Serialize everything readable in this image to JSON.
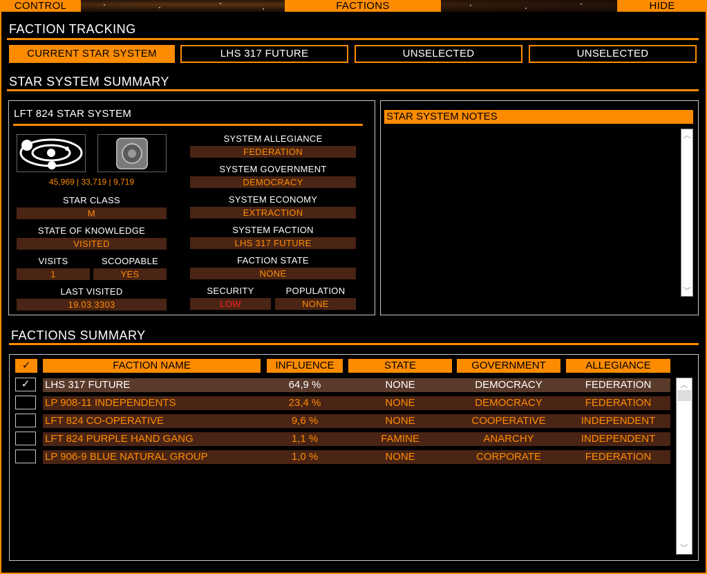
{
  "topbar": {
    "control": "CONTROL",
    "factions": "FACTIONS",
    "hide": "HIDE"
  },
  "tracking": {
    "title": "FACTION TRACKING",
    "buttons": [
      "CURRENT STAR SYSTEM",
      "LHS 317 FUTURE",
      "UNSELECTED",
      "UNSELECTED"
    ]
  },
  "summary": {
    "title": "STAR SYSTEM SUMMARY",
    "system_name": "LFT 824 STAR SYSTEM",
    "coords": "45,969 | 33,719 | 9,719",
    "star_class_label": "STAR CLASS",
    "star_class": "M",
    "knowledge_label": "STATE OF KNOWLEDGE",
    "knowledge": "VISITED",
    "visits_label": "VISITS",
    "visits": "1",
    "scoopable_label": "SCOOPABLE",
    "scoopable": "YES",
    "last_visited_label": "LAST VISITED",
    "last_visited": "19.03.3303",
    "allegiance_label": "SYSTEM ALLEGIANCE",
    "allegiance": "FEDERATION",
    "government_label": "SYSTEM GOVERNMENT",
    "government": "DEMOCRACY",
    "economy_label": "SYSTEM ECONOMY",
    "economy": "EXTRACTION",
    "faction_label": "SYSTEM FACTION",
    "faction": "LHS 317 FUTURE",
    "faction_state_label": "FACTION STATE",
    "faction_state": "NONE",
    "security_label": "SECURITY",
    "security": "LOW",
    "population_label": "POPULATION",
    "population": "NONE"
  },
  "notes": {
    "title": "STAR SYSTEM NOTES"
  },
  "factions": {
    "title": "FACTIONS SUMMARY",
    "headers": {
      "check": "✓",
      "name": "FACTION NAME",
      "influence": "INFLUENCE",
      "state": "STATE",
      "government": "GOVERNMENT",
      "allegiance": "ALLEGIANCE"
    },
    "rows": [
      {
        "checked": "✓",
        "name": "LHS 317 FUTURE",
        "influence": "64,9 %",
        "state": "NONE",
        "government": "DEMOCRACY",
        "allegiance": "FEDERATION"
      },
      {
        "checked": "",
        "name": "LP 908-11 INDEPENDENTS",
        "influence": "23,4 %",
        "state": "NONE",
        "government": "DEMOCRACY",
        "allegiance": "FEDERATION"
      },
      {
        "checked": "",
        "name": "LFT 824 CO-OPERATIVE",
        "influence": "9,6 %",
        "state": "NONE",
        "government": "COOPERATIVE",
        "allegiance": "INDEPENDENT"
      },
      {
        "checked": "",
        "name": "LFT 824 PURPLE HAND GANG",
        "influence": "1,1 %",
        "state": "FAMINE",
        "government": "ANARCHY",
        "allegiance": "INDEPENDENT"
      },
      {
        "checked": "",
        "name": "LP 906-9 BLUE NATURAL GROUP",
        "influence": "1,0 %",
        "state": "NONE",
        "government": "CORPORATE",
        "allegiance": "FEDERATION"
      }
    ]
  },
  "colors": {
    "accent": "#ff8c00",
    "value_bg": "#4a2414",
    "alert": "#ff2020"
  }
}
